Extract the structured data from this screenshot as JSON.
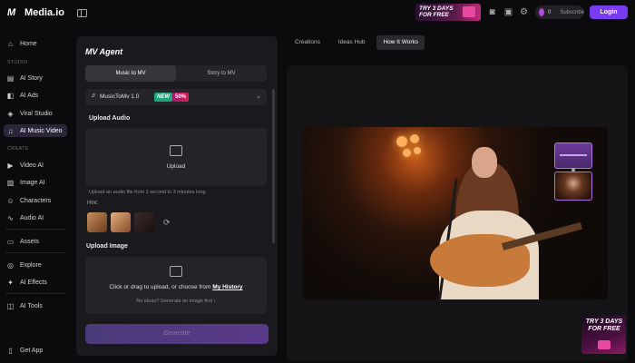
{
  "app": {
    "name": "Media.io",
    "logo_icon": "mi-logo-icon"
  },
  "topbar": {
    "promo_text": "TRY 3 DAYS FOR FREE",
    "credits": "0",
    "subscribe_label": "Subscribe",
    "login_label": "Login",
    "icons": [
      "discord-icon",
      "gift-icon",
      "gear-icon",
      "bell-icon"
    ]
  },
  "sidebar": {
    "home": "Home",
    "studio_section": "STUDIO",
    "studio_items": [
      "AI Story",
      "AI Ads",
      "Viral Studio",
      "AI Music Video"
    ],
    "create_section": "CREATE",
    "create_items": [
      "Video AI",
      "Image AI",
      "Characters",
      "Audio AI"
    ],
    "assets": "Assets",
    "explore_items": [
      "Explore",
      "AI Effects"
    ],
    "ai_tools": "AI Tools",
    "get_app": "Get App",
    "active_item": "AI Music Video"
  },
  "panel": {
    "title": "MV Agent",
    "modes": [
      "Music to MV",
      "Story to MV"
    ],
    "selected_mode": "Music to MV",
    "model_name": "MusicToMv 1.0",
    "model_badge_new": "NEW",
    "model_badge_discount": "50%",
    "upload_audio_label": "Upload Audio",
    "upload_audio_button": "Upload",
    "upload_audio_hint": "Upload an audio file from 1 second to 3 minutes long.",
    "hint_label": "Hint:",
    "upload_image_label": "Upload Image",
    "upload_image_text": "Click or drag to upload, or choose from",
    "upload_image_link": "My History",
    "no_idea_text": "No ideas? Generate an image first",
    "generate_label": "Generate"
  },
  "preview": {
    "tabs": [
      "Creations",
      "Ideas Hub",
      "How It Works"
    ],
    "active_tab": "How It Works"
  },
  "promo_corner": {
    "text": "TRY 3 DAYS FOR FREE"
  },
  "colors": {
    "accent": "#7a3cf0",
    "new_badge": "#1fa37a",
    "discount_badge": "#d8205a",
    "active_nav": "#2a2538"
  }
}
